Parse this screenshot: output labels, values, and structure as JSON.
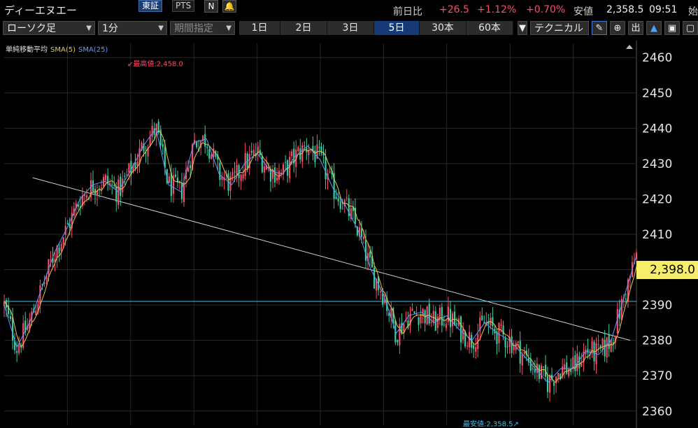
{
  "header": {
    "title": "ディーエヌエー",
    "exchange_tse": "東証",
    "exchange_pts": "PTS",
    "nikkei_icon_label": "N",
    "quote": {
      "change_label": "前日比",
      "change": "+26.5",
      "change_pct": "+1.12%",
      "extra_pct": "+0.70%",
      "low_label": "安値",
      "low_value": "2,358.5",
      "time": "09:51",
      "open_label": "始"
    }
  },
  "toolbar": {
    "chart_type": "ローソク足",
    "interval": "1分",
    "range_select": "期間指定",
    "periods": [
      "1日",
      "2日",
      "3日",
      "5日",
      "30本",
      "60本"
    ],
    "active_period": "5日",
    "technical": "テクニカル",
    "tool_labels": [
      "出"
    ]
  },
  "legend": {
    "label": "単純移動平均",
    "sma5": "SMA(5)",
    "sma25": "SMA(25)"
  },
  "annotations": {
    "high": "最高値:2,458.0",
    "low": "最安値:2,358.5"
  },
  "current_price": "2,398.0",
  "colors": {
    "up": "#ff4d6a",
    "down": "#36d1a6",
    "sma5": "#e6c64a",
    "sma25": "#5a9cff",
    "hline": "#39c4e8",
    "trendline": "#cfcfcf",
    "price_box": "#f6ee6a"
  },
  "chart_data": {
    "type": "line",
    "ylim": [
      2356,
      2464
    ],
    "y_ticks": [
      2360,
      2370,
      2380,
      2390,
      2400,
      2410,
      2420,
      2430,
      2440,
      2450,
      2460
    ],
    "grid": true,
    "reference_line": 2391,
    "trendline": [
      [
        0.045,
        2426
      ],
      [
        0.99,
        2380
      ]
    ],
    "annotations": [
      {
        "label": "最高値:2,458.0",
        "y": 2458.0
      },
      {
        "label": "最安値:2,358.5",
        "y": 2358.5
      }
    ],
    "series": [
      {
        "name": "SMA(25)",
        "x": [
          0,
          0.02,
          0.04,
          0.06,
          0.08,
          0.1,
          0.12,
          0.14,
          0.16,
          0.18,
          0.2,
          0.22,
          0.24,
          0.26,
          0.28,
          0.3,
          0.32,
          0.34,
          0.36,
          0.38,
          0.4,
          0.42,
          0.44,
          0.46,
          0.48,
          0.5,
          0.52,
          0.54,
          0.56,
          0.58,
          0.6,
          0.62,
          0.64,
          0.66,
          0.68,
          0.7,
          0.72,
          0.74,
          0.76,
          0.78,
          0.8,
          0.82,
          0.84,
          0.86,
          0.88,
          0.9,
          0.92,
          0.94,
          0.96,
          0.98,
          1.0
        ],
        "values": [
          2390,
          2378,
          2385,
          2395,
          2405,
          2412,
          2420,
          2424,
          2425,
          2422,
          2428,
          2435,
          2440,
          2424,
          2422,
          2436,
          2437,
          2427,
          2424,
          2430,
          2433,
          2428,
          2427,
          2432,
          2435,
          2431,
          2423,
          2418,
          2411,
          2400,
          2393,
          2382,
          2387,
          2388,
          2385,
          2387,
          2383,
          2380,
          2385,
          2382,
          2380,
          2376,
          2372,
          2368,
          2372,
          2372,
          2377,
          2376,
          2380,
          2392,
          2404
        ]
      }
    ]
  }
}
